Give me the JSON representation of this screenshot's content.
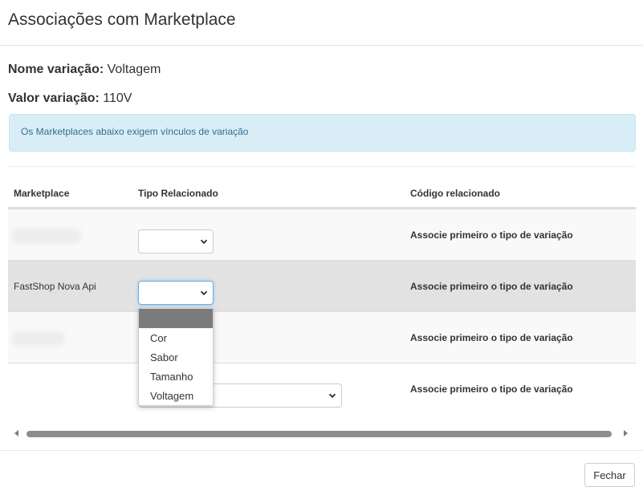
{
  "modal": {
    "title": "Associações com Marketplace"
  },
  "variation": {
    "name_label": "Nome variação:",
    "name_value": "Voltagem",
    "value_label": "Valor variação:",
    "value_value": "110V"
  },
  "alert": {
    "text": "Os Marketplaces abaixo exigem vínculos de variação"
  },
  "table": {
    "headers": [
      "Marketplace",
      "Tipo Relacionado",
      "Código relacionado"
    ],
    "rows": [
      {
        "marketplace": "",
        "selected": "",
        "code": "Associe primeiro o tipo de variação"
      },
      {
        "marketplace": "FastShop Nova Api",
        "selected": "",
        "code": "Associe primeiro o tipo de variação"
      },
      {
        "marketplace": "",
        "selected": "",
        "code": "Associe primeiro o tipo de variação"
      },
      {
        "marketplace": "",
        "selected": "",
        "code": "Associe primeiro o tipo de variação"
      }
    ]
  },
  "dropdown": {
    "options": [
      "",
      "Cor",
      "Sabor",
      "Tamanho",
      "Voltagem"
    ]
  },
  "footer": {
    "close_label": "Fechar"
  },
  "icons": {
    "select_arrow": "chevron-down-icon"
  }
}
